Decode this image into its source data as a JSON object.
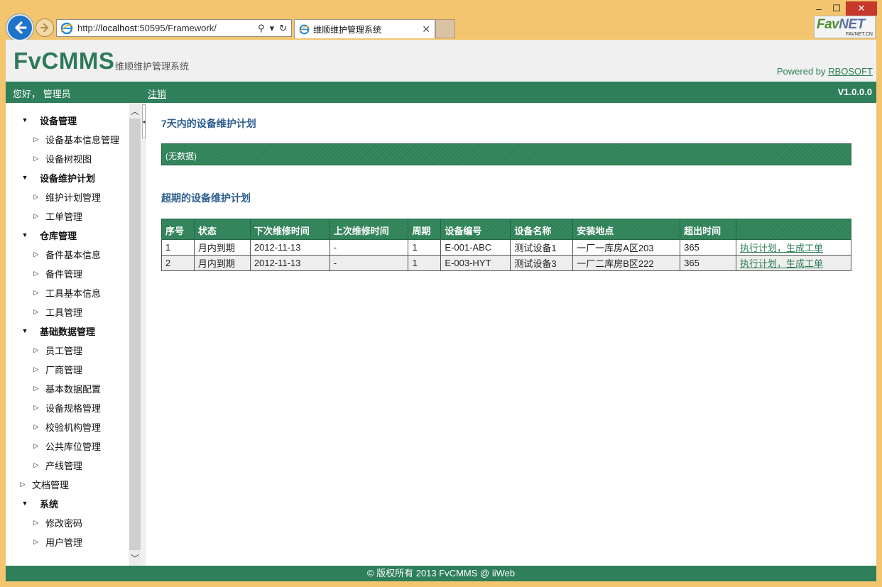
{
  "browser": {
    "url_prefix": "http://",
    "url_host": "localhost",
    "url_rest": ":50595/Framework/",
    "tab_title": "维顺维护管理系统",
    "logo_main": "Fav",
    "logo_accent": "NET",
    "logo_sub": "FAVNET.CN"
  },
  "header": {
    "app_name": "FvCMMS",
    "app_subtitle": "维顺维护管理系统",
    "powered_label": "Powered by ",
    "powered_link": "RBOSOFT"
  },
  "topbar": {
    "greeting": "您好， 管理员",
    "logout": "注销",
    "version": "V1.0.0.0"
  },
  "sidebar": {
    "items": [
      {
        "label": "设备管理",
        "level": 1,
        "expanded": true
      },
      {
        "label": "设备基本信息管理",
        "level": 2
      },
      {
        "label": "设备树视图",
        "level": 2
      },
      {
        "label": "设备维护计划",
        "level": 1,
        "expanded": true
      },
      {
        "label": "维护计划管理",
        "level": 2
      },
      {
        "label": "工单管理",
        "level": 2
      },
      {
        "label": "仓库管理",
        "level": 1,
        "expanded": true
      },
      {
        "label": "备件基本信息",
        "level": 2
      },
      {
        "label": "备件管理",
        "level": 2
      },
      {
        "label": "工具基本信息",
        "level": 2
      },
      {
        "label": "工具管理",
        "level": 2
      },
      {
        "label": "基础数据管理",
        "level": 1,
        "expanded": true
      },
      {
        "label": "员工管理",
        "level": 2
      },
      {
        "label": "厂商管理",
        "level": 2
      },
      {
        "label": "基本数据配置",
        "level": 2
      },
      {
        "label": "设备规格管理",
        "level": 2
      },
      {
        "label": "校验机构管理",
        "level": 2
      },
      {
        "label": "公共库位管理",
        "level": 2
      },
      {
        "label": "产线管理",
        "level": 2
      },
      {
        "label": "文档管理",
        "level": 1,
        "expanded": false
      },
      {
        "label": "系统",
        "level": 1,
        "expanded": true
      },
      {
        "label": "修改密码",
        "level": 2
      },
      {
        "label": "用户管理",
        "level": 2
      }
    ]
  },
  "main": {
    "section1_title": "7天内的设备维护计划",
    "section1_empty": "(无数据)",
    "section2_title": "超期的设备维护计划",
    "table": {
      "headers": [
        "序号",
        "状态",
        "下次维修时间",
        "上次维修时间",
        "周期",
        "设备编号",
        "设备名称",
        "安装地点",
        "超出时间",
        ""
      ],
      "rows": [
        [
          "1",
          "月内到期",
          "2012-11-13",
          "-",
          "1",
          "E-001-ABC",
          "测试设备1",
          "一厂一库房A区203",
          "365",
          "执行计划，生成工单"
        ],
        [
          "2",
          "月内到期",
          "2012-11-13",
          "-",
          "1",
          "E-003-HYT",
          "测试设备3",
          "一厂二库房B区222",
          "365",
          "执行计划，生成工单"
        ]
      ]
    }
  },
  "footer": {
    "text": "© 版权所有 2013 FvCMMS @ iiWeb"
  }
}
